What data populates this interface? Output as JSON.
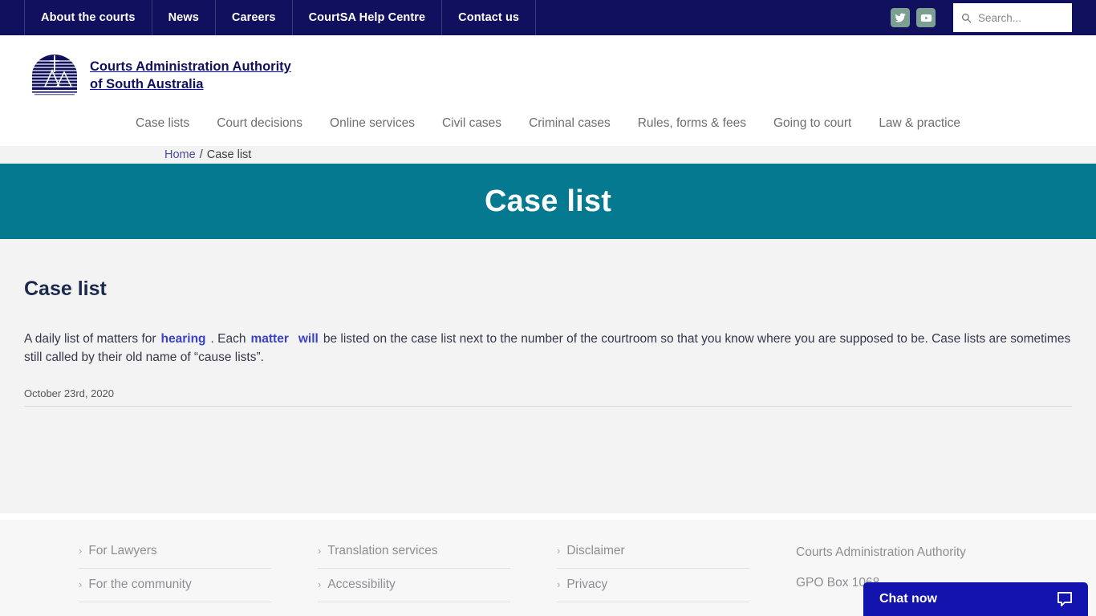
{
  "utility": {
    "links": [
      {
        "label": "About the courts"
      },
      {
        "label": "News"
      },
      {
        "label": "Careers"
      },
      {
        "label": "CourtSA Help Centre"
      },
      {
        "label": "Contact us"
      }
    ],
    "social": [
      {
        "name": "twitter-icon",
        "label": "Twitter"
      },
      {
        "name": "youtube-icon",
        "label": "YouTube"
      }
    ],
    "search": {
      "placeholder": "Search...",
      "value": ""
    }
  },
  "brand": {
    "name_line1": "Courts Administration Authority",
    "name_line2": "of South Australia",
    "full": "Courts Administration Authority\nof South Australia"
  },
  "main_nav": [
    {
      "label": "Case lists"
    },
    {
      "label": "Court decisions"
    },
    {
      "label": "Online services"
    },
    {
      "label": "Civil cases"
    },
    {
      "label": "Criminal cases"
    },
    {
      "label": "Rules, forms & fees"
    },
    {
      "label": "Going to court"
    },
    {
      "label": "Law & practice"
    }
  ],
  "breadcrumb": {
    "home": "Home",
    "separator": "/",
    "current": "Case list"
  },
  "hero": {
    "title": "Case list"
  },
  "content": {
    "heading": "Case list",
    "paragraph": {
      "part1": "A daily list of matters for",
      "link1": "hearing",
      "part2": ". Each",
      "link2": "matter",
      "link3": "will",
      "part3": "be listed on the case list next to the number of the courtroom so that you know where you are supposed to be. Case lists are sometimes still called by their old name of “cause lists”."
    },
    "date": "October 23rd, 2020"
  },
  "footer": {
    "columns": [
      {
        "links": [
          {
            "label": "For Lawyers"
          },
          {
            "label": "For the community"
          }
        ]
      },
      {
        "links": [
          {
            "label": "Translation services"
          },
          {
            "label": "Accessibility"
          }
        ]
      },
      {
        "links": [
          {
            "label": "Disclaimer"
          },
          {
            "label": "Privacy"
          }
        ]
      }
    ],
    "address": {
      "line1": "Courts Administration Authority",
      "line2": "GPO Box 1068"
    }
  },
  "chat": {
    "label": "Chat now",
    "icon": "chat-bubble-icon"
  },
  "colors": {
    "navy": "#11105e",
    "teal": "#04798f",
    "link_blue": "#3b41c9",
    "chat_blue": "#1313ad",
    "social_green": "#7ba092",
    "body_bg": "#f3f3f4",
    "footer_bg": "#f7f7f8"
  }
}
